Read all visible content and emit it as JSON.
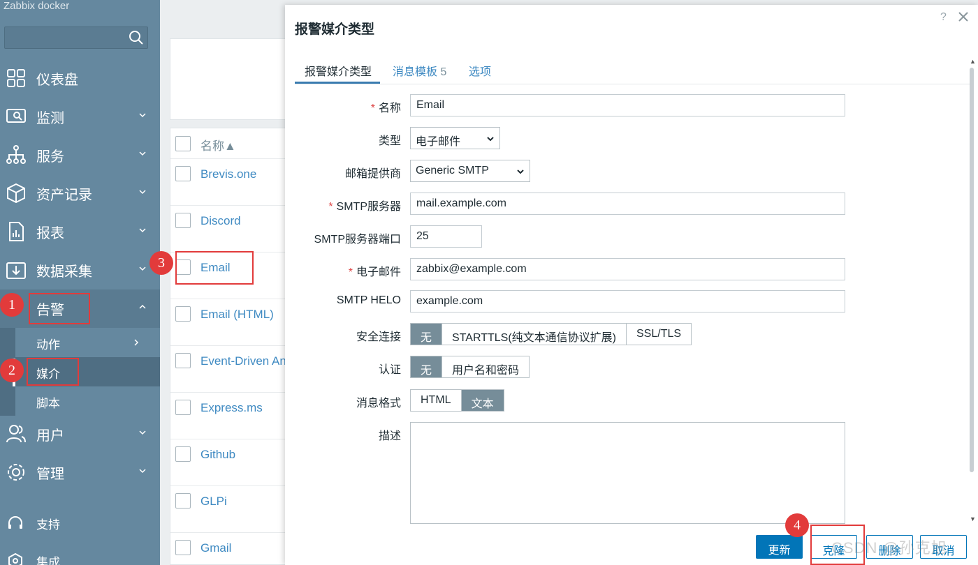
{
  "app": {
    "brand": "Zabbix docker"
  },
  "sidebar": {
    "items": [
      {
        "label": "仪表盘",
        "icon": "dashboard-icon"
      },
      {
        "label": "监测",
        "icon": "monitoring-icon"
      },
      {
        "label": "服务",
        "icon": "services-icon"
      },
      {
        "label": "资产记录",
        "icon": "inventory-icon"
      },
      {
        "label": "报表",
        "icon": "reports-icon"
      },
      {
        "label": "数据采集",
        "icon": "data-collection-icon"
      },
      {
        "label": "告警",
        "icon": "alerts-icon"
      },
      {
        "label": "用户",
        "icon": "users-icon"
      },
      {
        "label": "管理",
        "icon": "gear-icon"
      }
    ],
    "submenu": [
      {
        "label": "动作"
      },
      {
        "label": "媒介"
      },
      {
        "label": "脚本"
      }
    ],
    "footer": [
      {
        "label": "支持",
        "icon": "headset-icon"
      },
      {
        "label": "集成",
        "icon": "integrations-icon"
      }
    ]
  },
  "list": {
    "header": "名称▲",
    "rows": [
      "Brevis.one",
      "Discord",
      "Email",
      "Email (HTML)",
      "Event-Driven Ans",
      "Express.ms",
      "Github",
      "GLPi",
      "Gmail"
    ]
  },
  "modal": {
    "title": "报警媒介类型",
    "help": "?",
    "tabs": [
      {
        "label": "报警媒介类型"
      },
      {
        "label": "消息模板",
        "count": "5"
      },
      {
        "label": "选项"
      }
    ],
    "form": {
      "name_label": "名称",
      "name_value": "Email",
      "type_label": "类型",
      "type_value": "电子邮件",
      "provider_label": "邮箱提供商",
      "provider_value": "Generic SMTP",
      "smtp_server_label": "SMTP服务器",
      "smtp_server_value": "mail.example.com",
      "smtp_port_label": "SMTP服务器端口",
      "smtp_port_value": "25",
      "email_label": "电子邮件",
      "email_value": "zabbix@example.com",
      "helo_label": "SMTP HELO",
      "helo_value": "example.com",
      "security_label": "安全连接",
      "security_options": [
        "无",
        "STARTTLS(纯文本通信协议扩展)",
        "SSL/TLS"
      ],
      "auth_label": "认证",
      "auth_options": [
        "无",
        "用户名和密码"
      ],
      "format_label": "消息格式",
      "format_options": [
        "HTML",
        "文本"
      ],
      "desc_label": "描述",
      "desc_value": ""
    },
    "buttons": {
      "update": "更新",
      "clone": "克隆",
      "delete": "删除",
      "cancel": "取消"
    }
  },
  "annotations": [
    "1",
    "2",
    "3",
    "4"
  ],
  "watermark": "CSDN @孙克旭",
  "colors": {
    "sidebar": "#65889f",
    "accent": "#0275b8",
    "annotation": "#e23b3b",
    "segment_on": "#768d99"
  }
}
